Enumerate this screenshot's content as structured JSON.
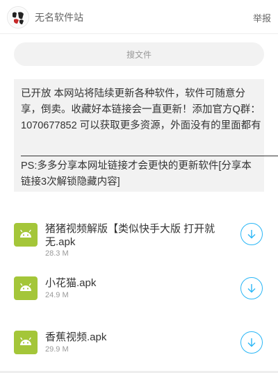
{
  "header": {
    "site_title": "无名软件站",
    "report_label": "举报"
  },
  "search": {
    "placeholder": "搜文件"
  },
  "notice": {
    "text": "已开放 本网站将陆续更新各种软件，软件可随意分享，倒卖。收藏好本链接会一直更新！添加官方Q群：1070677852 可以获取更多资源，外面没有的里面都有",
    "ps": "PS:多多分享本网址链接才会更快的更新软件[分享本链接3次解锁隐藏内容]"
  },
  "files": [
    {
      "name": "猪猪视频解版【类似快手大版 打开就无.apk",
      "size": "28.3 M",
      "icon": "android-icon"
    },
    {
      "name": "小花猫.apk",
      "size": "24.9 M",
      "icon": "android-icon"
    },
    {
      "name": "香蕉视频.apk",
      "size": "29.9 M",
      "icon": "android-icon"
    }
  ],
  "colors": {
    "android_green": "#a4c639",
    "download_blue": "#29b6f6"
  }
}
